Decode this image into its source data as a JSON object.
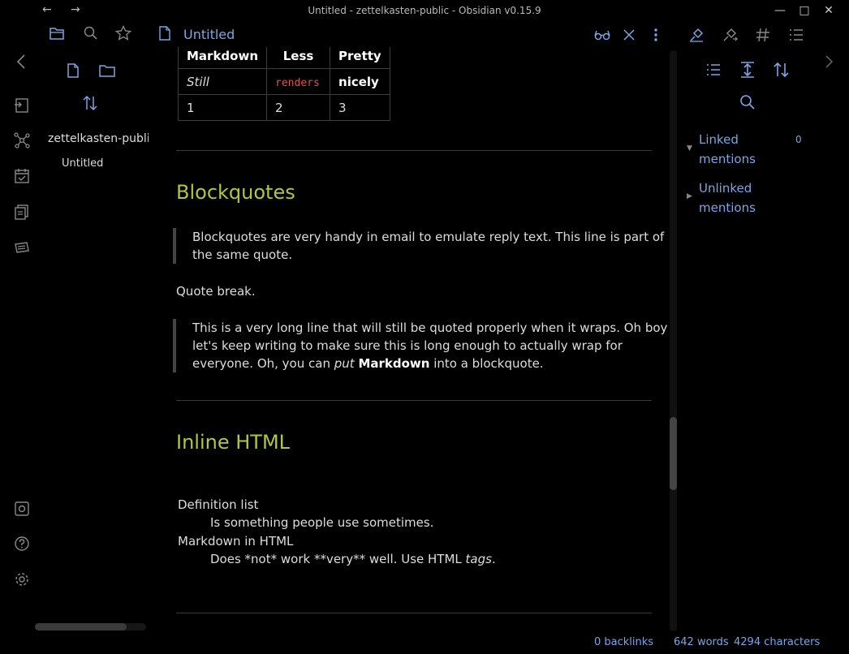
{
  "window": {
    "title": "Untitled - zettelkasten-public - Obsidian v0.15.9"
  },
  "file_explorer": {
    "vault_name": "zettelkasten-public",
    "files": [
      "Untitled"
    ]
  },
  "tab": {
    "title": "Untitled"
  },
  "document": {
    "table": {
      "headers": [
        "Markdown",
        "Less",
        "Pretty"
      ],
      "row1": [
        "Still",
        "renders",
        "nicely"
      ],
      "row2": [
        "1",
        "2",
        "3"
      ]
    },
    "blockquotes_heading": "Blockquotes",
    "quote1": "Blockquotes are very handy in email to emulate reply text. This line is part of the same quote.",
    "quote_break": "Quote break.",
    "quote2": {
      "text1": "This is a very long line that will still be quoted properly when it wraps. Oh boy let's keep writing to make sure this is long enough to actually wrap for everyone. Oh, you can ",
      "em": "put",
      "strong": "Markdown",
      "text2": " into a blockquote."
    },
    "inline_html_heading": "Inline HTML",
    "definitions": {
      "term1": "Definition list",
      "def1": "Is something people use sometimes.",
      "term2": "Markdown in HTML",
      "def2_text": "Does *not* work **very** well. Use HTML ",
      "def2_em": "tags",
      "def2_end": "."
    }
  },
  "backlinks": {
    "linked": "Linked mentions",
    "linked_count": "0",
    "unlinked": "Unlinked mentions"
  },
  "statusbar": {
    "backlinks": "0 backlinks",
    "words": "642 words",
    "characters": "4294 characters"
  },
  "colors": {
    "accent": "#7aa6e6",
    "heading": "#b2c53e",
    "code": "#e05252"
  }
}
